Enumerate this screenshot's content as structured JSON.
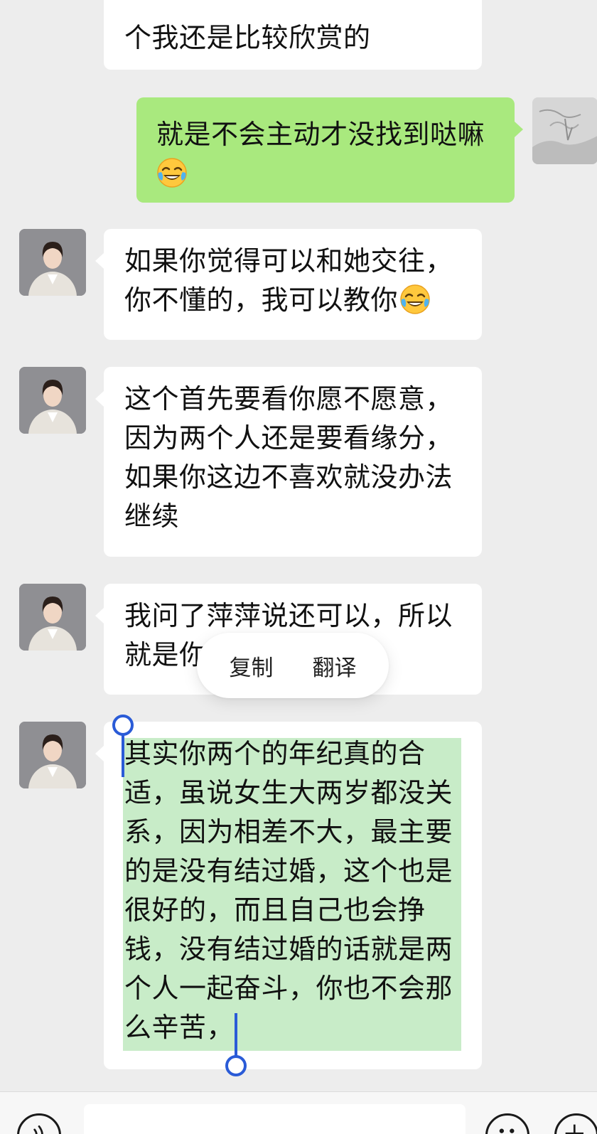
{
  "messages": [
    {
      "sender": "other",
      "partial": true,
      "lines": [
        "个我还是比较欣赏的"
      ]
    },
    {
      "sender": "self",
      "lines": [
        "就是不会主动才没找到哒嘛"
      ],
      "emoji": "crying-laughing-emoji"
    },
    {
      "sender": "other",
      "lines": [
        "如果你觉得可以和她交往，",
        "你不懂的，我可以教你"
      ],
      "emoji": "crying-laughing-emoji"
    },
    {
      "sender": "other",
      "lines": [
        "这个首先要看你愿不愿意，",
        "因为两个人还是要看缘分，",
        "如果你这边不喜欢就没办法",
        "继续"
      ]
    },
    {
      "sender": "other",
      "lines": [
        "我问了萍萍说还可以，所以",
        "就是你"
      ]
    },
    {
      "sender": "other",
      "selected": true,
      "lines": [
        "其实你两个的年纪真的合",
        "适，虽说女生大两岁都没关",
        "系，因为相差不大，最主要",
        "的是没有结过婚，这个也是",
        "很好的，而且自己也会挣",
        "钱，没有结过婚的话就是两",
        "个人一起奋斗，你也不会那",
        "么辛苦，"
      ]
    }
  ],
  "context_menu": {
    "copy": "复制",
    "translate": "翻译"
  },
  "colors": {
    "background": "#ededed",
    "self_bubble": "#a9e97e",
    "other_bubble": "#ffffff",
    "selection": "#c8ecc8",
    "selection_handle": "#2a5bd7"
  },
  "icons": {
    "voice": "voice-icon",
    "emoji": "emoji-icon",
    "plus": "plus-icon"
  }
}
